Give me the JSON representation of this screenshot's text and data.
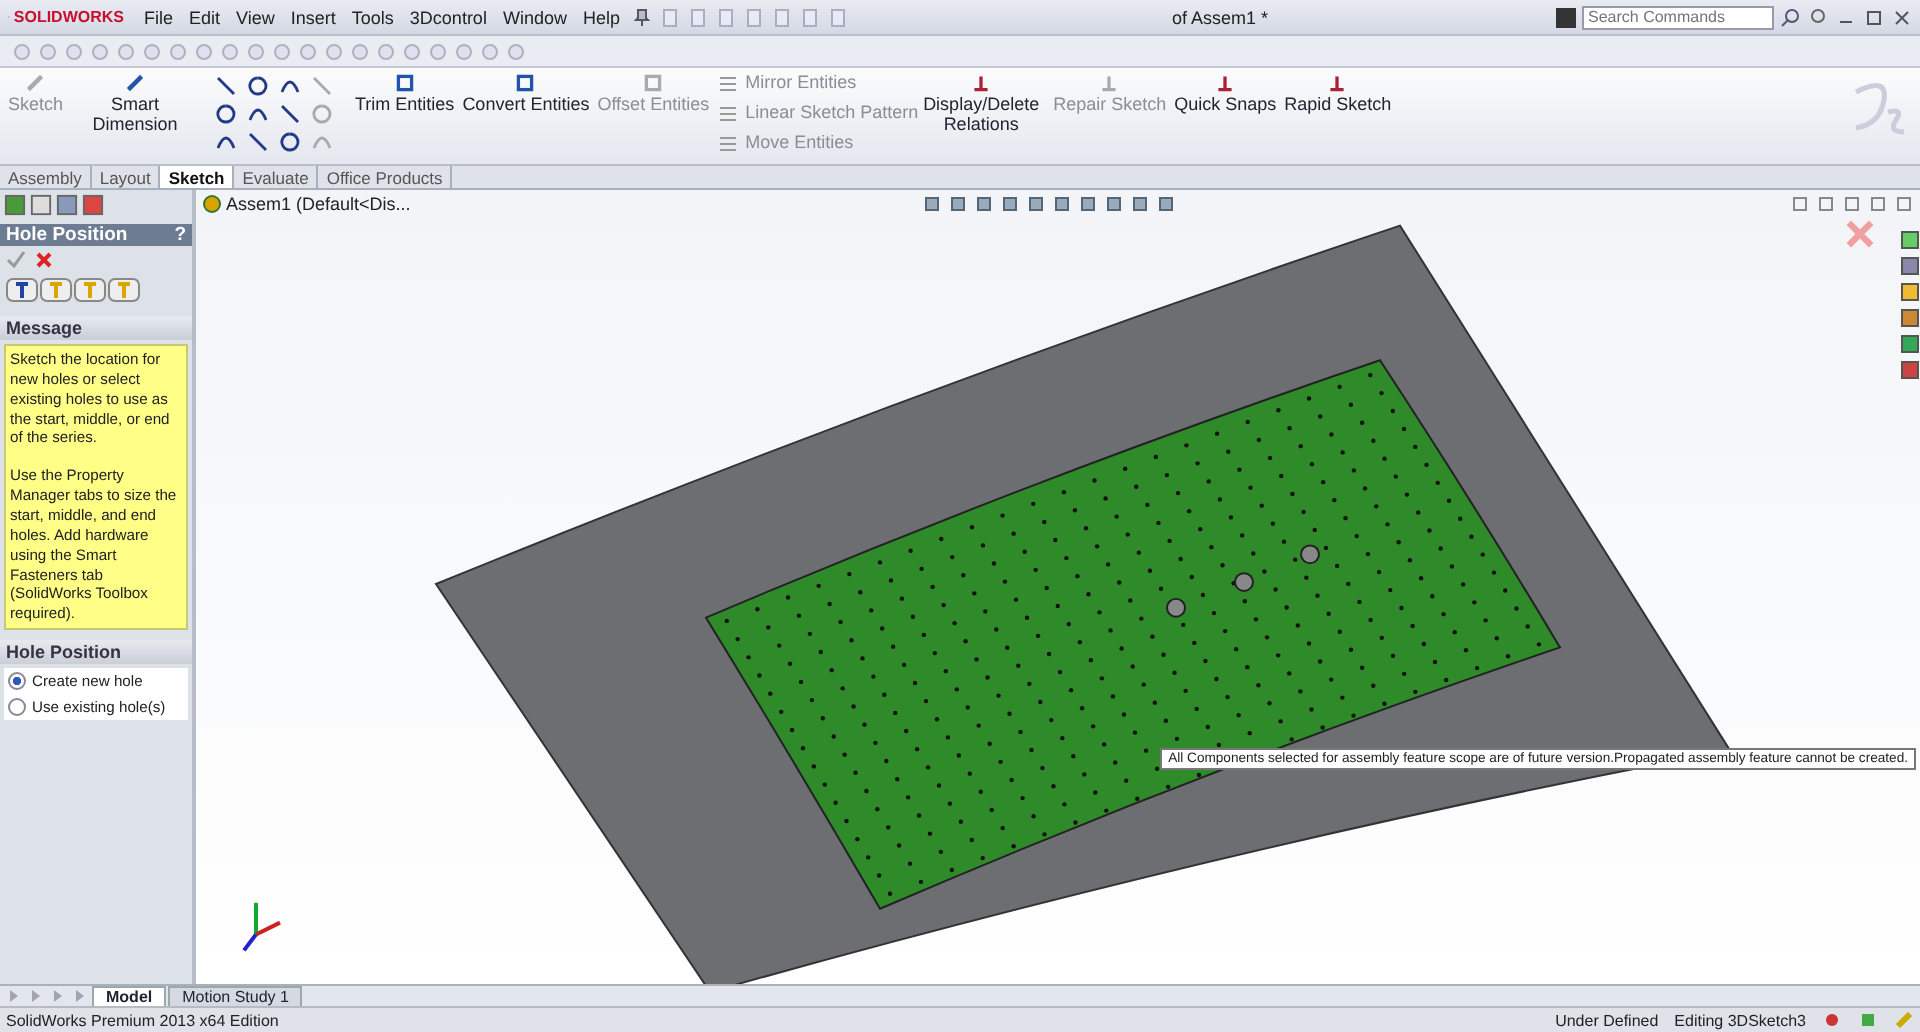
{
  "window": {
    "logo": "SOLIDWORKS",
    "title": "of Assem1 *"
  },
  "menu": [
    "File",
    "Edit",
    "View",
    "Insert",
    "Tools",
    "3Dcontrol",
    "Window",
    "Help"
  ],
  "search": {
    "placeholder": "Search Commands"
  },
  "ribbon": {
    "left_buttons": [
      {
        "label": "Sketch",
        "disabled": true
      },
      {
        "label": "Smart Dimension",
        "disabled": false
      }
    ],
    "middle_buttons": [
      {
        "label": "Trim Entities",
        "disabled": false
      },
      {
        "label": "Convert Entities",
        "disabled": false
      },
      {
        "label": "Offset Entities",
        "disabled": true
      }
    ],
    "stacked": [
      {
        "label": "Mirror Entities",
        "disabled": true
      },
      {
        "label": "Linear Sketch Pattern",
        "disabled": true
      },
      {
        "label": "Move Entities",
        "disabled": true
      }
    ],
    "right_buttons": [
      {
        "label": "Display/Delete Relations",
        "disabled": false
      },
      {
        "label": "Repair Sketch",
        "disabled": true
      },
      {
        "label": "Quick Snaps",
        "disabled": false
      },
      {
        "label": "Rapid Sketch",
        "disabled": false
      }
    ]
  },
  "tabs": [
    {
      "label": "Assembly",
      "selected": false
    },
    {
      "label": "Layout",
      "selected": false
    },
    {
      "label": "Sketch",
      "selected": true
    },
    {
      "label": "Evaluate",
      "selected": false
    },
    {
      "label": "Office Products",
      "selected": false
    }
  ],
  "property_manager": {
    "title": "Hole Position",
    "help": "?",
    "message": {
      "heading": "Message",
      "paragraphs": [
        "Sketch the location for new holes or select existing holes to use as the start, middle, or end of the series.",
        "Use the Property Manager tabs to size the start, middle, and end holes. Add hardware using the Smart Fasteners tab (SolidWorks Toolbox required)."
      ]
    },
    "section": {
      "heading": "Hole Position",
      "options": [
        {
          "label": "Create new hole",
          "selected": true
        },
        {
          "label": "Use existing hole(s)",
          "selected": false
        }
      ]
    }
  },
  "tree": {
    "root": "Assem1  (Default<Dis..."
  },
  "tooltip": "All Components selected for assembly feature scope are of future version.Propagated assembly feature cannot be created.",
  "bottom_tabs": [
    {
      "label": "Model",
      "selected": true
    },
    {
      "label": "Motion Study 1",
      "selected": false
    }
  ],
  "status_bar": {
    "product": "SolidWorks Premium 2013 x64 Edition",
    "state": "Under Defined",
    "mode": "Editing 3DSketch3"
  }
}
